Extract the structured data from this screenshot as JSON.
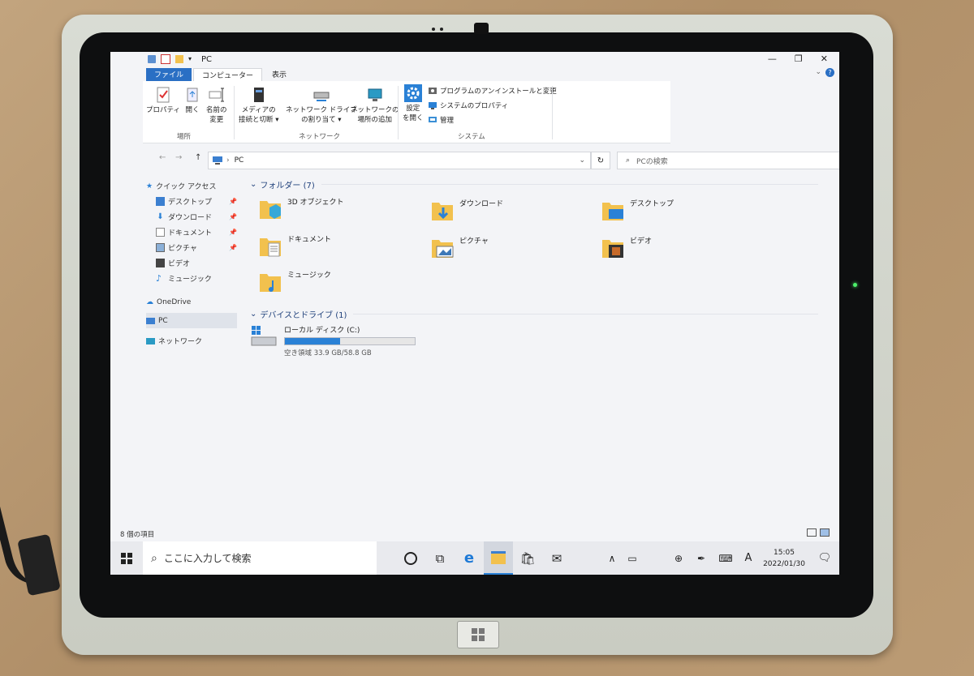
{
  "window": {
    "title": "PC",
    "controls": {
      "minimize": "—",
      "maximize": "❐",
      "close": "✕"
    },
    "help_icon": "?"
  },
  "ribbon": {
    "tabs": [
      "ファイル",
      "コンピューター",
      "表示"
    ],
    "buttons": {
      "properties": "プロパティ",
      "open": "開く",
      "rename_1": "名前の",
      "rename_2": "変更",
      "media_1": "メディアの",
      "media_2": "接続と切断 ▾",
      "netdrive_1": "ネットワーク ドライブ",
      "netdrive_2": "の割り当て ▾",
      "netloc_1": "ネットワークの",
      "netloc_2": "場所の追加",
      "settings_1": "設定",
      "settings_2": "を開く",
      "uninstall": "プログラムのアンインストールと変更",
      "sysprops": "システムのプロパティ",
      "manage": "管理"
    },
    "groups": {
      "location": "場所",
      "network": "ネットワーク",
      "system": "システム"
    }
  },
  "address": {
    "path": "PC",
    "back": "←",
    "forward": "→",
    "up": "↑",
    "dropdown": "⌄",
    "refresh": "↻",
    "search_placeholder": "PCの検索"
  },
  "nav": {
    "quick_access": "クイック アクセス",
    "items": [
      "デスクトップ",
      "ダウンロード",
      "ドキュメント",
      "ピクチャ",
      "ビデオ",
      "ミュージック"
    ],
    "onedrive": "OneDrive",
    "pc": "PC",
    "network": "ネットワーク"
  },
  "content": {
    "folders_header": "フォルダー (7)",
    "folders": [
      "3D オブジェクト",
      "ダウンロード",
      "デスクトップ",
      "ドキュメント",
      "ピクチャ",
      "ビデオ",
      "ミュージック"
    ],
    "devices_header": "デバイスとドライブ (1)",
    "drive": {
      "name": "ローカル ディスク (C:)",
      "free_text": "空き領域 33.9 GB/58.8 GB",
      "used_fraction": 0.423
    }
  },
  "status": {
    "items_count": "8 個の項目"
  },
  "taskbar": {
    "search_placeholder": "ここに入力して検索",
    "ime": "A",
    "time": "15:05",
    "date": "2022/01/30"
  },
  "colors": {
    "accent": "#2a81d6",
    "file_tab": "#2a6fc4",
    "folder": "#f2c14e"
  }
}
